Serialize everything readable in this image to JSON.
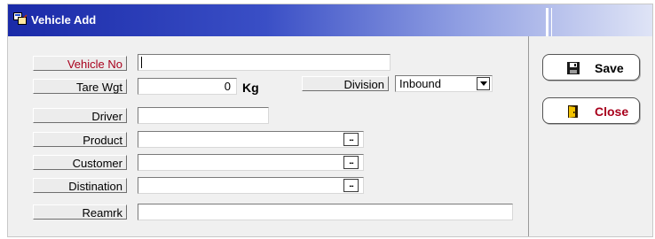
{
  "window": {
    "title": "Vehicle Add"
  },
  "form": {
    "vehicle_no": {
      "label": "Vehicle No",
      "value": ""
    },
    "tare_wgt": {
      "label": "Tare Wgt",
      "value": "0",
      "unit": "Kg"
    },
    "division": {
      "label": "Division",
      "value": "Inbound"
    },
    "driver": {
      "label": "Driver",
      "value": ""
    },
    "product": {
      "label": "Product",
      "value": "",
      "lookup_label": "..."
    },
    "customer": {
      "label": "Customer",
      "value": "",
      "lookup_label": "..."
    },
    "distination": {
      "label": "Distination",
      "value": "",
      "lookup_label": "..."
    },
    "reamrk": {
      "label": "Reamrk",
      "value": ""
    }
  },
  "buttons": {
    "save": {
      "label": "Save",
      "icon": "floppy-disk-icon"
    },
    "close": {
      "label": "Close",
      "icon": "door-exit-icon"
    }
  },
  "colors": {
    "title_bar": "#1a2aa8",
    "required_label": "#a8001c",
    "close_text": "#a8001c"
  }
}
